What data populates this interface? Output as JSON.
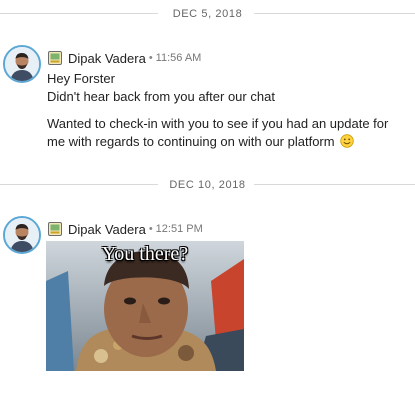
{
  "dividers": [
    {
      "label": "DEC 5, 2018"
    },
    {
      "label": "DEC 10, 2018"
    }
  ],
  "messages": [
    {
      "sender": "Dipak Vadera",
      "separator": "•",
      "time": "11:56 AM",
      "lines": [
        "Hey Forster",
        "Didn't hear back from you after our chat",
        "Wanted to check-in with you to see if you had an update for me with regards to continuing on with our platform"
      ],
      "emoji": "smiley-emoji-icon"
    },
    {
      "sender": "Dipak Vadera",
      "separator": "•",
      "time": "12:51 PM",
      "gif_caption": "You there?"
    }
  ],
  "colors": {
    "avatar_ring": "#5aa7d6",
    "divider_line": "#d9d9d9"
  }
}
